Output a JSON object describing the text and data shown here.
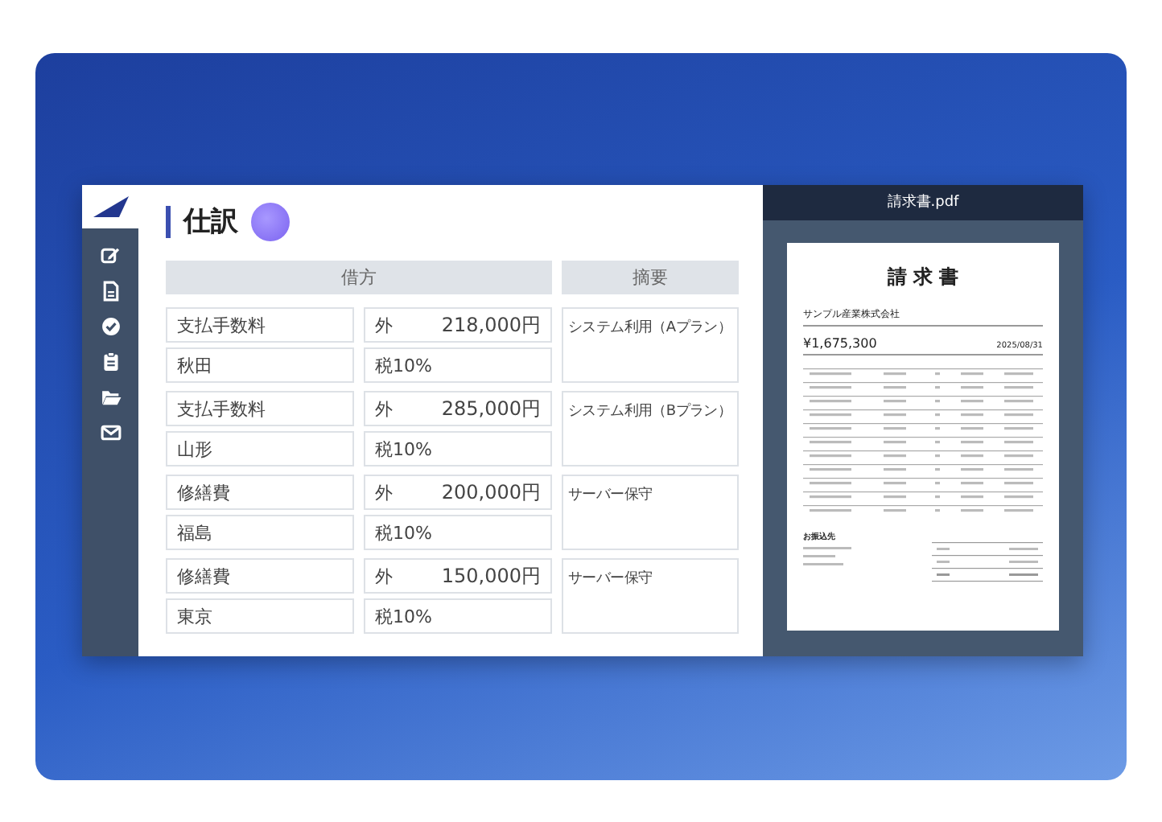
{
  "sidebar": {
    "items": [
      {
        "kind": "edit"
      },
      {
        "kind": "document"
      },
      {
        "kind": "check"
      },
      {
        "kind": "clipboard"
      },
      {
        "kind": "folder"
      },
      {
        "kind": "mail"
      }
    ]
  },
  "journal": {
    "title": "仕訳",
    "columns": [
      "借方",
      "摘要"
    ],
    "entries": [
      {
        "account": "支払手数料",
        "place": "秋田",
        "prefix": "外",
        "amount": "218,000円",
        "tax": "税10%",
        "memo": "システム利用（Aプラン）"
      },
      {
        "account": "支払手数料",
        "place": "山形",
        "prefix": "外",
        "amount": "285,000円",
        "tax": "税10%",
        "memo": "システム利用（Bプラン）"
      },
      {
        "account": "修繕費",
        "place": "福島",
        "prefix": "外",
        "amount": "200,000円",
        "tax": "税10%",
        "memo": "サーバー保守"
      },
      {
        "account": "修繕費",
        "place": "東京",
        "prefix": "外",
        "amount": "150,000円",
        "tax": "税10%",
        "memo": "サーバー保守"
      }
    ]
  },
  "pdf": {
    "filename": "請求書.pdf",
    "title": "請 求 書",
    "customer": "サンプル産業株式会社",
    "amount": "¥1,675,300",
    "date": "2025/08/31",
    "bank_title": "お振込先"
  }
}
